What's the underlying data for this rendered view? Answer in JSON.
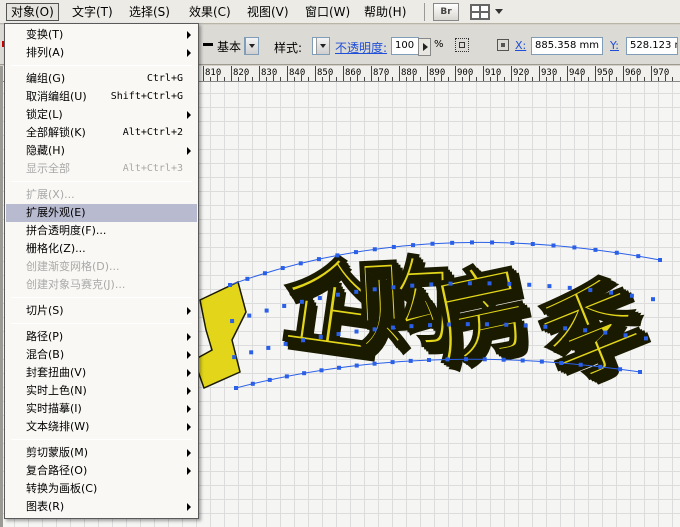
{
  "menubar": {
    "items": [
      {
        "label": "对象(O)",
        "active": true
      },
      {
        "label": "文字(T)"
      },
      {
        "label": "选择(S)"
      },
      {
        "label": "效果(C)"
      },
      {
        "label": "视图(V)"
      },
      {
        "label": "窗口(W)"
      },
      {
        "label": "帮助(H)"
      }
    ],
    "bridge_label": "Br"
  },
  "controlbar": {
    "stroke_style": "基本",
    "style_label": "样式:",
    "opacity_label": "不透明度:",
    "opacity_value": "100",
    "percent": "%",
    "x_label": "X:",
    "x_value": "885.358 mm",
    "y_label": "Y:",
    "y_value": "528.123 m"
  },
  "ruler": {
    "labels": [
      "810",
      "820",
      "830",
      "840",
      "850",
      "860",
      "870",
      "880",
      "890",
      "900",
      "910",
      "920",
      "930",
      "940",
      "950",
      "960",
      "970"
    ]
  },
  "object_menu": {
    "items": [
      {
        "label": "变换(T)",
        "submenu": true
      },
      {
        "label": "排列(A)",
        "submenu": true
      },
      {
        "separator": true
      },
      {
        "label": "编组(G)",
        "shortcut": "Ctrl+G"
      },
      {
        "label": "取消编组(U)",
        "shortcut": "Shift+Ctrl+G"
      },
      {
        "label": "锁定(L)",
        "submenu": true
      },
      {
        "label": "全部解锁(K)",
        "shortcut": "Alt+Ctrl+2"
      },
      {
        "label": "隐藏(H)",
        "submenu": true
      },
      {
        "label": "显示全部",
        "shortcut": "Alt+Ctrl+3",
        "disabled": true
      },
      {
        "separator": true
      },
      {
        "label": "扩展(X)...",
        "disabled": true
      },
      {
        "label": "扩展外观(E)",
        "highlight": true
      },
      {
        "label": "拼合透明度(F)..."
      },
      {
        "label": "栅格化(Z)..."
      },
      {
        "label": "创建渐变网格(D)...",
        "disabled": true
      },
      {
        "label": "创建对象马赛克(J)...",
        "disabled": true
      },
      {
        "separator": true
      },
      {
        "label": "切片(S)",
        "submenu": true
      },
      {
        "separator": true
      },
      {
        "label": "路径(P)",
        "submenu": true
      },
      {
        "label": "混合(B)",
        "submenu": true
      },
      {
        "label": "封套扭曲(V)",
        "submenu": true
      },
      {
        "label": "实时上色(N)",
        "submenu": true
      },
      {
        "label": "实时描摹(I)",
        "submenu": true
      },
      {
        "label": "文本绕排(W)",
        "submenu": true
      },
      {
        "separator": true
      },
      {
        "label": "剪切蒙版(M)",
        "submenu": true
      },
      {
        "label": "复合路径(O)",
        "submenu": true
      },
      {
        "label": "转换为画板(C)"
      },
      {
        "label": "图表(R)",
        "submenu": true
      }
    ]
  },
  "artwork": {
    "text": "企购房季",
    "fill": "#e3d61a",
    "extrude": "#9a8f08",
    "outline": "#1a1a00",
    "anchor": "#2a5fe8"
  },
  "icons": {
    "bridge": "bridge-icon",
    "workspace": "workspace-grid-icon",
    "align": "align-icon",
    "transform": "transform-icon"
  }
}
